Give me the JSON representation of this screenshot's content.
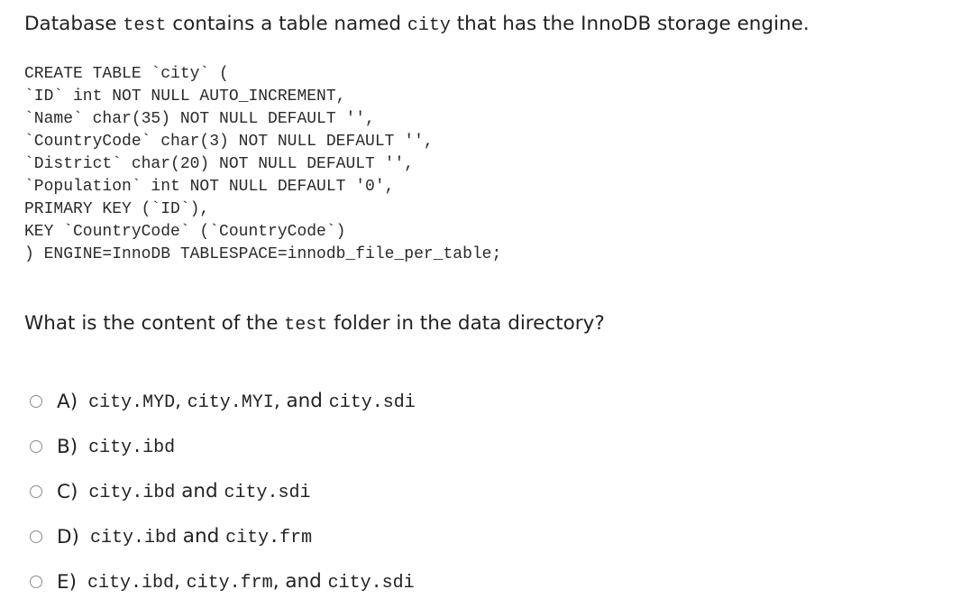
{
  "intro": {
    "part1": "Database ",
    "db_name": "test",
    "part2": " contains a table named ",
    "table_name": "city",
    "part3": " that has the InnoDB storage engine."
  },
  "code": [
    "CREATE TABLE `city` (",
    "`ID` int NOT NULL AUTO_INCREMENT,",
    "`Name` char(35) NOT NULL DEFAULT '',",
    "`CountryCode` char(3) NOT NULL DEFAULT '',",
    "`District` char(20) NOT NULL DEFAULT '',",
    "`Population` int NOT NULL DEFAULT '0',",
    "PRIMARY KEY (`ID`),",
    "KEY `CountryCode` (`CountryCode`)",
    ") ENGINE=InnoDB TABLESPACE=innodb_file_per_table;"
  ],
  "question": {
    "part1": "What is the content of the ",
    "folder": "test",
    "part2": " folder in the data directory?"
  },
  "options": [
    {
      "letter": "A)",
      "f1": "city.MYD",
      "s1": ", ",
      "f2": "city.MYI",
      "s2": ", and ",
      "f3": "city.sdi"
    },
    {
      "letter": "B)",
      "f1": "city.ibd"
    },
    {
      "letter": "C)",
      "f1": "city.ibd",
      "s1": " and ",
      "f2": "city.sdi"
    },
    {
      "letter": "D)",
      "f1": "city.ibd",
      "s1": " and ",
      "f2": "city.frm"
    },
    {
      "letter": "E)",
      "f1": "city.ibd",
      "s1": ", ",
      "f2": "city.frm",
      "s2": ", and ",
      "f3": "city.sdi"
    }
  ]
}
